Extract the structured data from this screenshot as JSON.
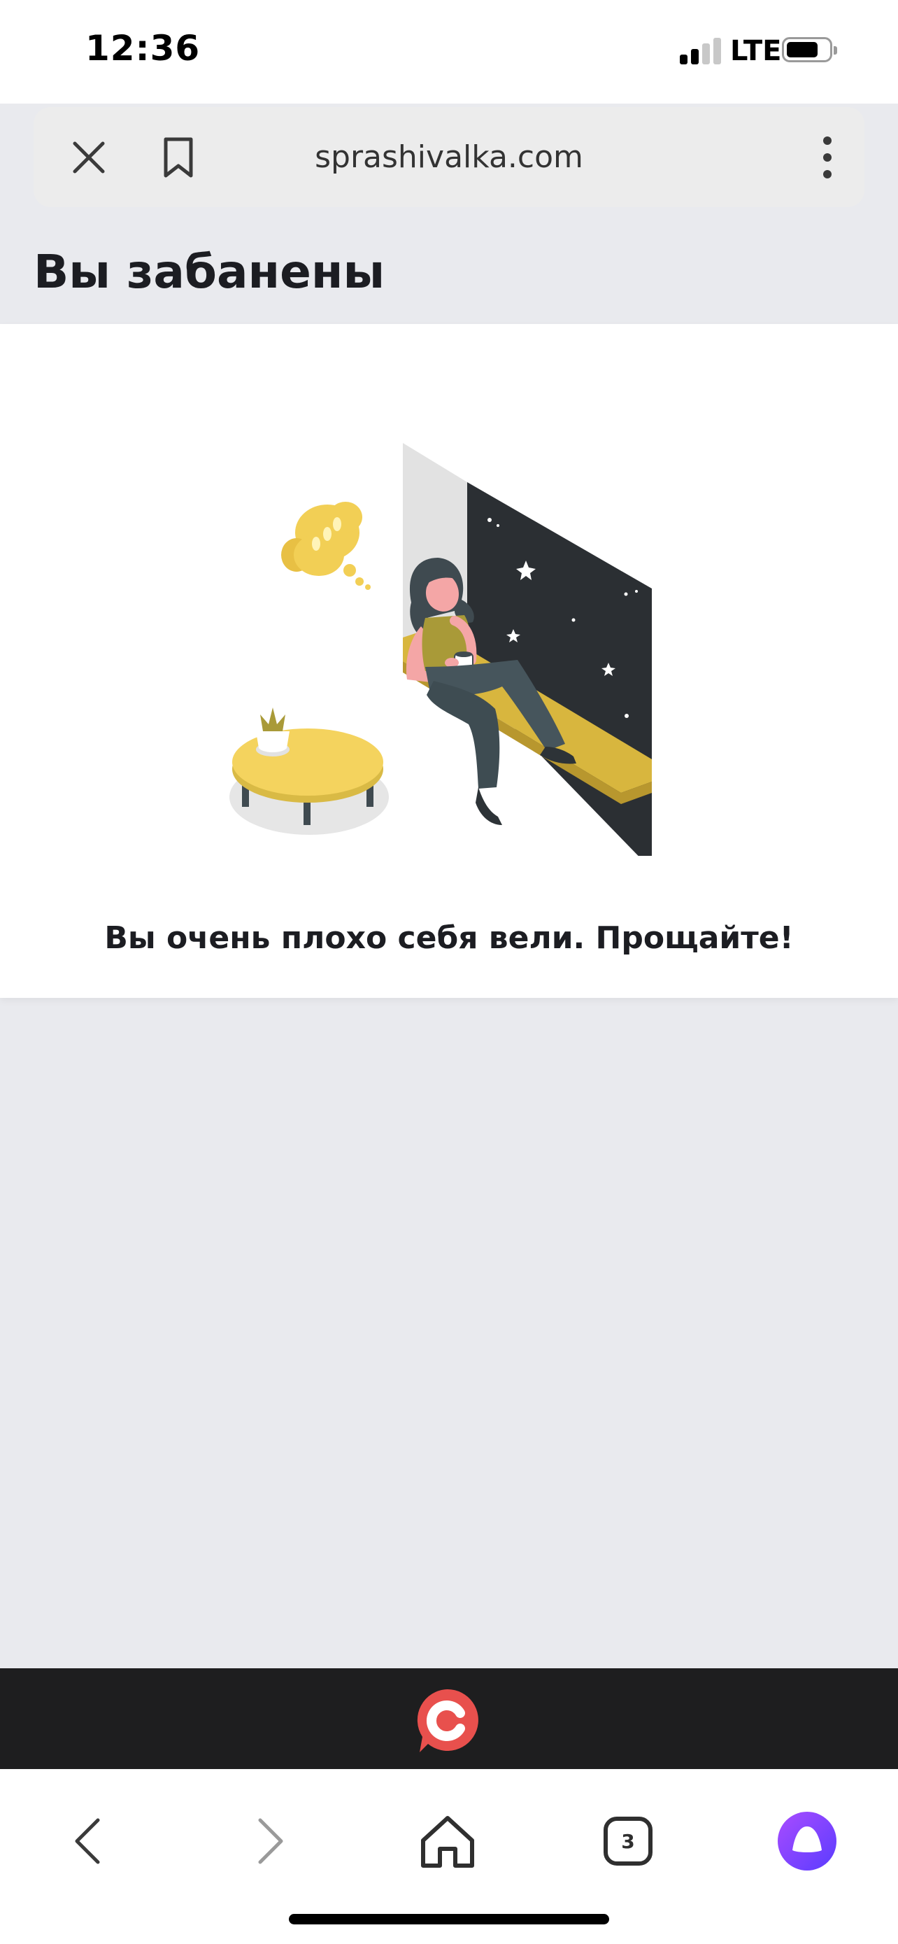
{
  "status_bar": {
    "time": "12:36",
    "network": "LTE",
    "signal_bars_active": 2,
    "signal_bars_total": 4,
    "battery_icon": "battery-icon"
  },
  "browser": {
    "url": "sprashivalka.com",
    "close_icon": "close-icon",
    "bookmark_icon": "bookmark-icon",
    "menu_icon": "more-vertical-icon"
  },
  "page": {
    "title": "Вы забанены",
    "message": "Вы очень плохо себя вели. Прощайте!",
    "illustration": "woman-sitting-on-windowsill-illustration"
  },
  "brand": {
    "logo_icon": "sprashivalka-logo-icon"
  },
  "nav": {
    "back_icon": "chevron-left-icon",
    "forward_icon": "chevron-right-icon",
    "home_icon": "home-icon",
    "tabs_count": "3",
    "assistant_icon": "alice-assistant-icon"
  },
  "colors": {
    "accent_yellow": "#f4d35e",
    "night_sky": "#2b2f33",
    "brand_red": "#e8504d",
    "assistant_purple": "#7b4bff"
  }
}
